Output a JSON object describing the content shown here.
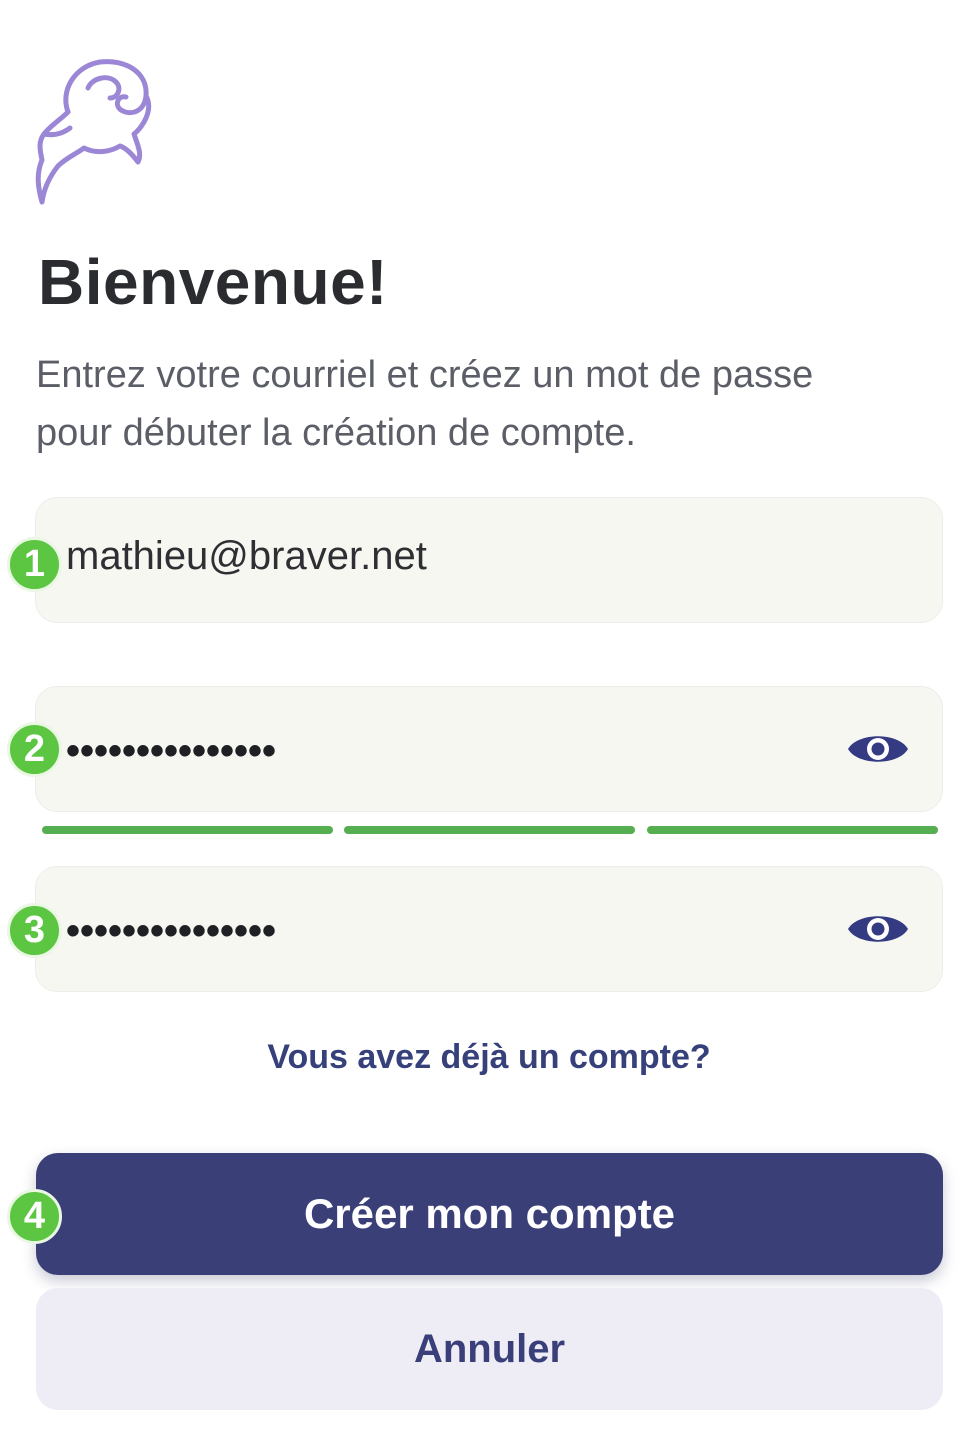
{
  "colors": {
    "primary": "#3a3f78",
    "accent_logo": "#9b87d6",
    "badge": "#5cc542",
    "strength": "#55ae4f",
    "link": "#36407a",
    "field_bg": "#f7f7f2",
    "secondary_bg": "#eeedf6"
  },
  "header": {
    "logo_icon": "ram-logo-icon",
    "title": "Bienvenue!",
    "subtitle_line1": "Entrez votre courriel et créez un mot de passe",
    "subtitle_line2": "pour débuter la création de compte."
  },
  "form": {
    "email_value": "mathieu@braver.net",
    "password_value": "•••••••••••••••",
    "password_strength_filled": 3,
    "password_strength_total": 3,
    "confirm_value": "•••••••••••••••",
    "visibility_icon": "eye-icon"
  },
  "badges": [
    "1",
    "2",
    "3",
    "4"
  ],
  "links": {
    "has_account": "Vous avez déjà un compte?"
  },
  "buttons": {
    "create": "Créer mon compte",
    "cancel": "Annuler"
  }
}
